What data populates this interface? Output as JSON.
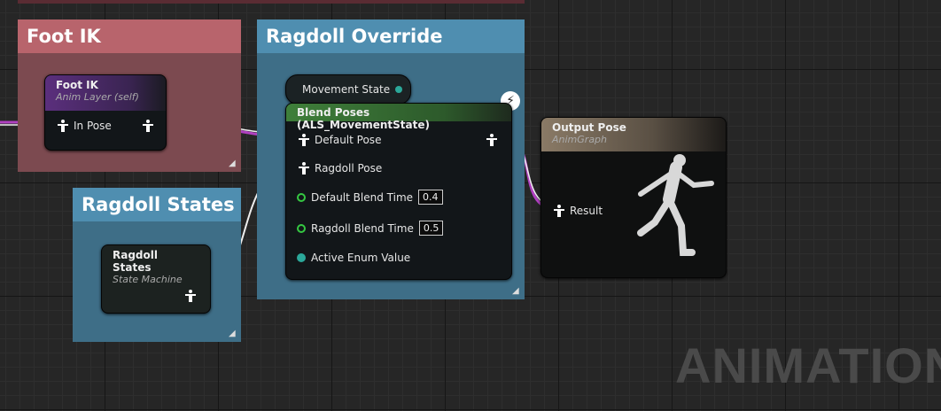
{
  "comments": {
    "foot_ik": "Foot IK",
    "ragdoll_override": "Ragdoll Override",
    "ragdoll_states": "Ragdoll States"
  },
  "nodes": {
    "foot_ik": {
      "title": "Foot IK",
      "subtitle": "Anim Layer (self)",
      "pin_in": "In Pose"
    },
    "movement_state": {
      "title": "Movement State"
    },
    "blend": {
      "title": "Blend Poses (ALS_MovementState)",
      "pins": {
        "default_pose": "Default Pose",
        "ragdoll_pose": "Ragdoll Pose",
        "default_blend_time": "Default Blend Time",
        "default_blend_value": "0.4",
        "ragdoll_blend_time": "Ragdoll Blend Time",
        "ragdoll_blend_value": "0.5",
        "active_enum": "Active Enum Value"
      }
    },
    "output_pose": {
      "title": "Output Pose",
      "subtitle": "AnimGraph",
      "pin_result": "Result"
    },
    "ragdoll_states": {
      "title": "Ragdoll States",
      "subtitle": "State Machine"
    }
  },
  "watermark": "ANIMATION",
  "colors": {
    "pose_wire": "#ffffff",
    "layer_wire": "#b040c0",
    "enum_pin": "#2ba89a",
    "float_pin": "#35c842"
  }
}
